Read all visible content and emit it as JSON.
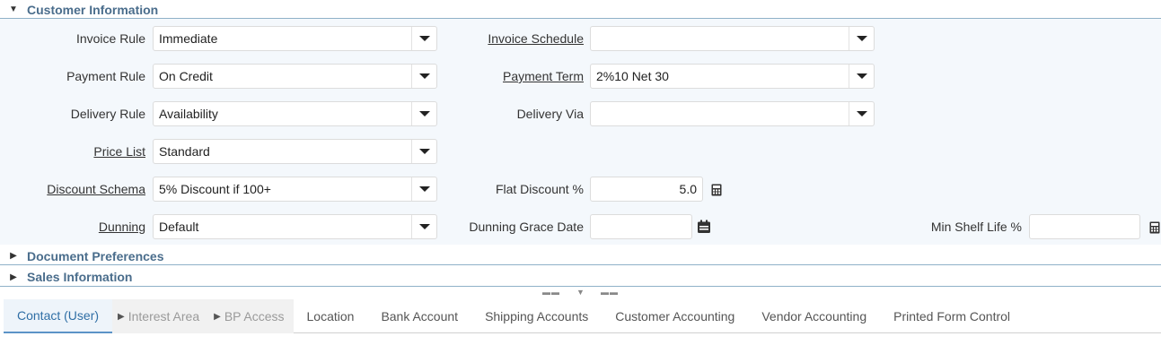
{
  "sections": {
    "customer": {
      "title": "Customer Information"
    },
    "document": {
      "title": "Document Preferences"
    },
    "sales": {
      "title": "Sales Information"
    }
  },
  "fields": {
    "invoice_rule": {
      "label": "Invoice Rule",
      "value": "Immediate"
    },
    "invoice_schedule": {
      "label": "Invoice Schedule",
      "value": ""
    },
    "payment_rule": {
      "label": "Payment Rule",
      "value": "On Credit"
    },
    "payment_term": {
      "label": "Payment Term",
      "value": "2%10 Net 30"
    },
    "delivery_rule": {
      "label": "Delivery Rule",
      "value": "Availability"
    },
    "delivery_via": {
      "label": "Delivery Via",
      "value": ""
    },
    "price_list": {
      "label": "Price List",
      "value": "Standard"
    },
    "discount_schema": {
      "label": "Discount Schema",
      "value": "5% Discount if 100+"
    },
    "flat_discount": {
      "label": "Flat Discount %",
      "value": "5.0"
    },
    "dunning": {
      "label": "Dunning",
      "value": "Default"
    },
    "dunning_grace_date": {
      "label": "Dunning Grace Date",
      "value": ""
    },
    "min_shelf_life": {
      "label": "Min Shelf Life %",
      "value": ""
    }
  },
  "tabs": [
    {
      "label": "Contact (User)"
    },
    {
      "label": "Interest Area"
    },
    {
      "label": "BP Access"
    },
    {
      "label": "Location"
    },
    {
      "label": "Bank Account"
    },
    {
      "label": "Shipping Accounts"
    },
    {
      "label": "Customer Accounting"
    },
    {
      "label": "Vendor Accounting"
    },
    {
      "label": "Printed Form Control"
    }
  ],
  "icons": {
    "expanded": "caret-down-icon",
    "collapsed": "caret-right-icon",
    "dropdown": "chevron-down-icon",
    "calculator": "calculator-icon",
    "calendar": "calendar-icon"
  },
  "colors": {
    "section_title": "#4a6d8c",
    "panel_bg": "#f4f8fc",
    "active_tab": "#2f6ea5"
  }
}
